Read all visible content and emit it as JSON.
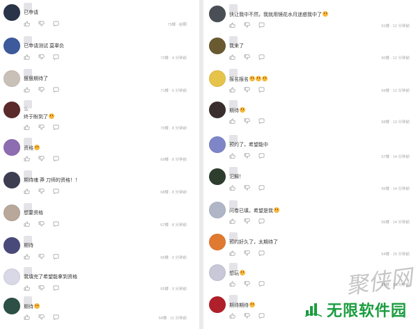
{
  "comments_left": [
    {
      "text": "已申请",
      "emoji": false,
      "meta": "73楼 · 前期",
      "avatar": "#2a3448"
    },
    {
      "text": "已申请测试 莫辜负",
      "emoji": false,
      "meta": "72楼 · 4 分钟前",
      "avatar": "#3c5a9c"
    },
    {
      "text": "狠狠期待了",
      "emoji": false,
      "meta": "71楼 · 5 分钟前",
      "avatar": "#c9c0b8"
    },
    {
      "text": "终于盼到了",
      "emoji": true,
      "meta": "70楼 · 8 分钟前",
      "avatar": "#5b2a2a",
      "decoration": "么"
    },
    {
      "text": "资格",
      "emoji": true,
      "meta": "69楼 · 8 分钟前",
      "avatar": "#8e6cb1"
    },
    {
      "text": "期待魂 莽 刀师的资格！！",
      "emoji": false,
      "meta": "68楼 · 8 分钟前",
      "avatar": "#3e3e52"
    },
    {
      "text": "想要资格",
      "emoji": false,
      "meta": "67楼 · 8 分钟前",
      "avatar": "#b8a89a"
    },
    {
      "text": "期待",
      "emoji": false,
      "meta": "66楼 · 9 分钟前",
      "avatar": "#4a4a7a"
    },
    {
      "text": "我填完了希望能拿到资格",
      "emoji": false,
      "meta": "65楼 · 9 分钟前",
      "avatar": "#d8d8e6"
    },
    {
      "text": "期待",
      "emoji": true,
      "meta": "64楼 · 11 分钟前",
      "avatar": "#2d5046"
    }
  ],
  "comments_right": [
    {
      "text": "快让我中不然，我就用镜花水月迷惑我中了",
      "emoji": true,
      "meta": "61楼 · 12 分钟前",
      "avatar": "#4a4f56"
    },
    {
      "text": "我来了",
      "emoji": false,
      "meta": "60楼 · 12 分钟前",
      "avatar": "#6a5a30"
    },
    {
      "text": "报名报名",
      "emoji": true,
      "emoji_count": 3,
      "meta": "59楼 · 12 分钟前",
      "avatar": "#e6c34a"
    },
    {
      "text": "期待",
      "emoji": true,
      "meta": "58楼 · 13 分钟前",
      "avatar": "#3a2e2e"
    },
    {
      "text": "预约了，希望能中",
      "emoji": false,
      "meta": "57楼 · 14 分钟前",
      "avatar": "#7e86c8"
    },
    {
      "text": "汜解！",
      "emoji": false,
      "meta": "56楼 · 14 分钟前",
      "avatar": "#2e3e2e"
    },
    {
      "text": "问卷已填，希望是我",
      "emoji": true,
      "meta": "55楼 · 14 分钟前",
      "avatar": "#b0b6c8"
    },
    {
      "text": "预约好久了，太期待了",
      "emoji": false,
      "meta": "54楼 · 15 分钟前",
      "avatar": "#e07a30"
    },
    {
      "text": "想玩",
      "emoji": true,
      "meta": "53楼 · 15 分钟前",
      "avatar": "#c8c8d8"
    },
    {
      "text": "期待期待",
      "emoji": true,
      "meta": "52楼 · 16 分钟前",
      "avatar": "#b0202a"
    }
  ],
  "watermark": {
    "stylized": "聚侠网",
    "brand": "无限软件园"
  },
  "colors": {
    "text": "#333333",
    "meta": "#a8a8a8",
    "brand": "#1a9d3f"
  }
}
